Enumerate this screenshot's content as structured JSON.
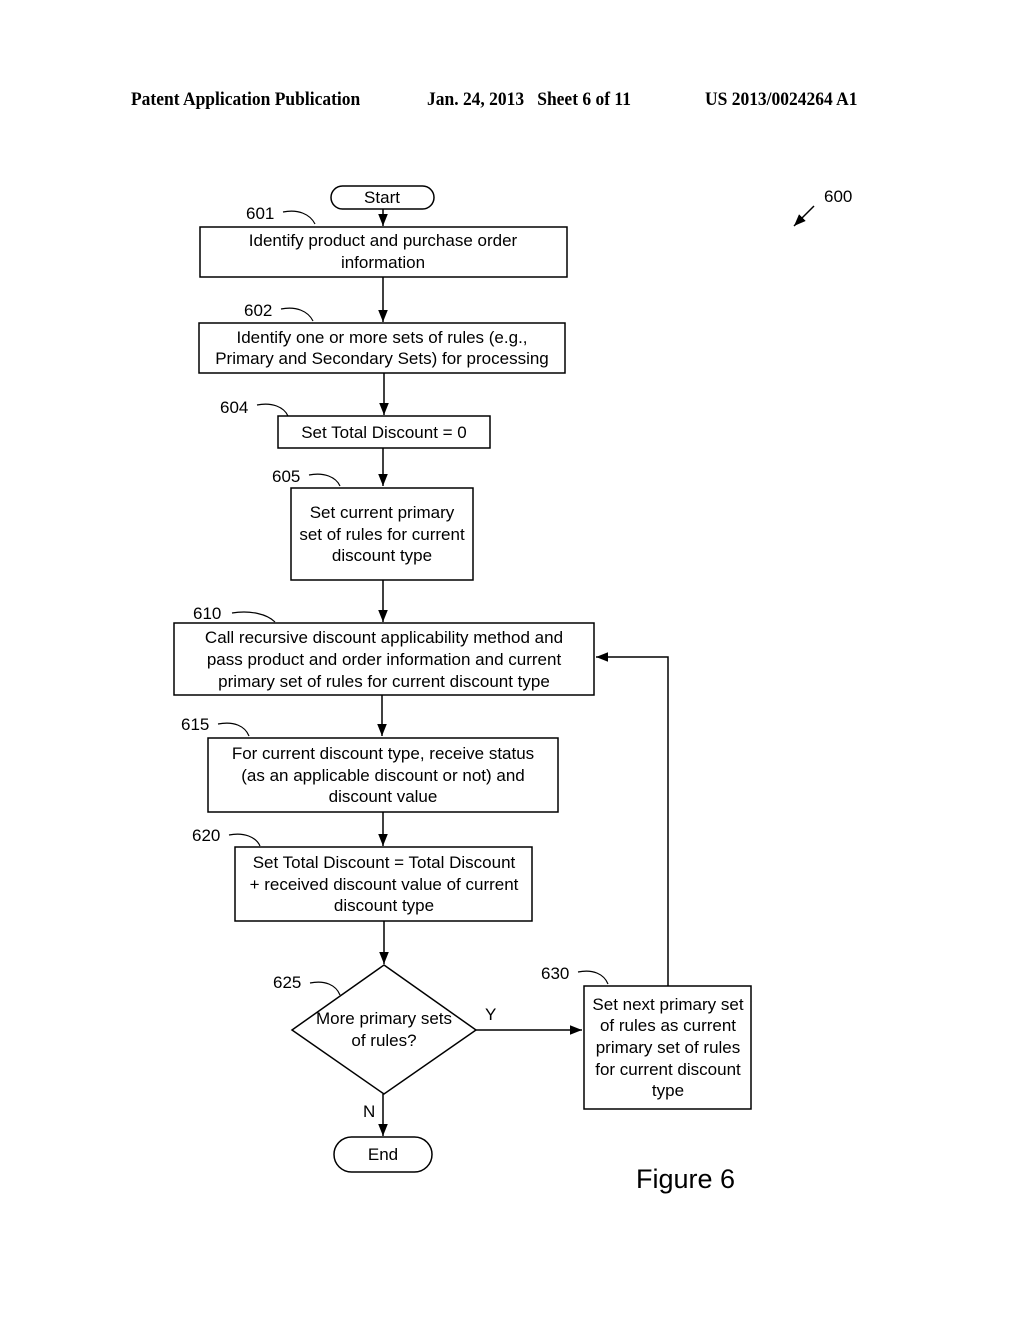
{
  "header": {
    "publication": "Patent Application Publication",
    "date_sheet": "Jan. 24, 2013   Sheet 6 of 11",
    "number": "US 2013/0024264 A1"
  },
  "figure": {
    "ref": "600",
    "caption": "Figure 6"
  },
  "flowchart": {
    "start": "Start",
    "end": "End",
    "steps": [
      {
        "ref": "601",
        "lines": [
          "Identify product and purchase order",
          "information"
        ]
      },
      {
        "ref": "602",
        "lines": [
          "Identify one or more sets of rules (e.g.,",
          "Primary and Secondary Sets) for processing"
        ]
      },
      {
        "ref": "604",
        "lines": [
          "Set Total Discount  = 0"
        ]
      },
      {
        "ref": "605",
        "lines": [
          "Set current primary",
          "set of rules for current",
          "discount type"
        ]
      },
      {
        "ref": "610",
        "lines": [
          "Call recursive discount applicability method and",
          "pass product and order information and current",
          "primary set of rules for current discount type"
        ]
      },
      {
        "ref": "615",
        "lines": [
          "For current discount type, receive status",
          "(as an applicable discount or not) and",
          "discount value"
        ]
      },
      {
        "ref": "620",
        "lines": [
          "Set Total Discount = Total Discount",
          "+ received discount value of current",
          "discount type"
        ]
      },
      {
        "ref": "630",
        "lines": [
          "Set next primary set",
          "of rules as current",
          "primary set of rules",
          "for current discount",
          "type"
        ]
      }
    ],
    "decision": {
      "ref": "625",
      "lines": [
        "More primary sets",
        "of rules?"
      ],
      "yes_label": "Y",
      "no_label": "N"
    }
  }
}
